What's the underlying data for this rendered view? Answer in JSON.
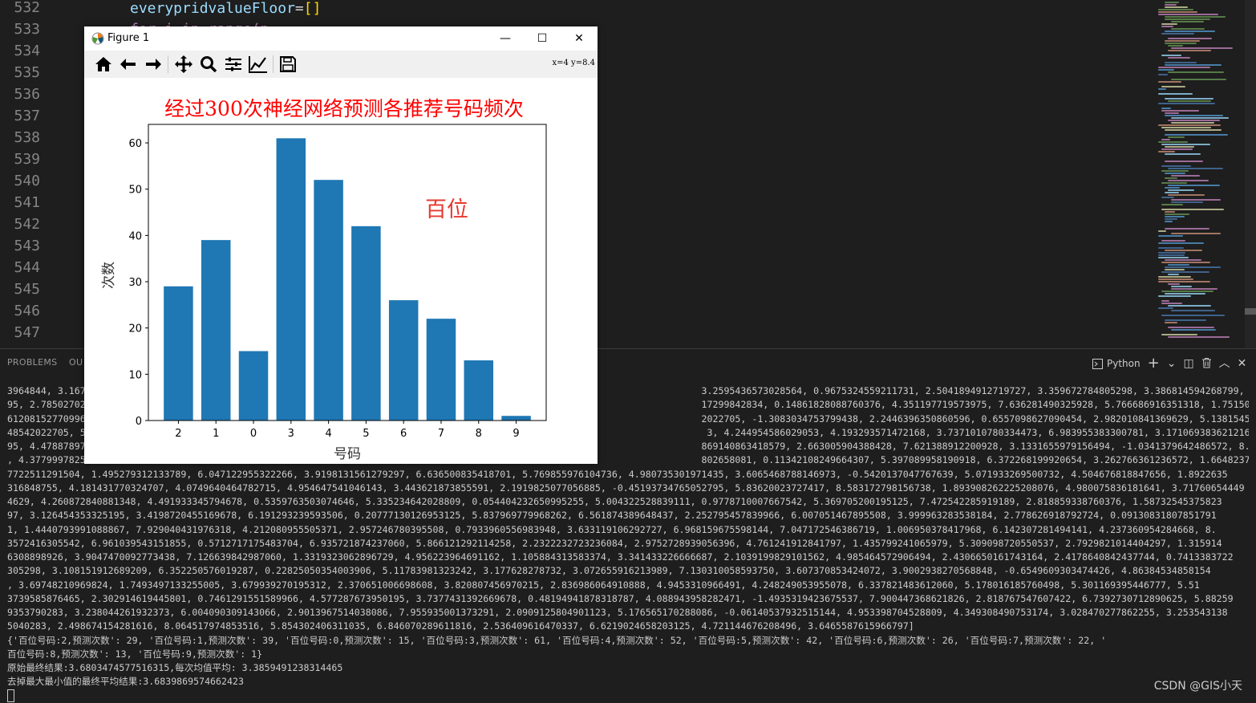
{
  "editor": {
    "line_numbers": [
      "532",
      "533",
      "534",
      "535",
      "536",
      "537",
      "538",
      "539",
      "540",
      "541",
      "542",
      "543",
      "544",
      "545",
      "546",
      "547"
    ],
    "code_line_532": {
      "ident": "everypridvalueFloor",
      "op": "=",
      "brackets": "[]"
    },
    "code_line_533": "for i in range(p"
  },
  "window": {
    "title": "Figure 1",
    "coords_readout": "x=4 y=8.4",
    "controls": {
      "minimize": "—",
      "maximize": "☐",
      "close": "✕"
    }
  },
  "toolbar_icons": [
    "home-icon",
    "back-arrow-icon",
    "forward-arrow-icon",
    "pan-icon",
    "zoom-icon",
    "subplots-config-icon",
    "edit-axis-icon",
    "save-icon"
  ],
  "chart_data": {
    "type": "bar",
    "title": "经过300次神经网络预测各推荐号码频次",
    "annotation": "百位",
    "xlabel": "号码",
    "ylabel": "次数",
    "categories": [
      "2",
      "1",
      "0",
      "3",
      "4",
      "5",
      "6",
      "7",
      "8",
      "9"
    ],
    "values": [
      29,
      39,
      15,
      61,
      52,
      42,
      26,
      22,
      13,
      1
    ],
    "ylim": [
      0,
      64
    ],
    "yticks": [
      0,
      10,
      20,
      30,
      40,
      50,
      60
    ],
    "bar_color": "#1f77b4",
    "title_color": "#ff0000",
    "annotation_color": "#e8392f",
    "grid": false
  },
  "panel": {
    "tabs": [
      "PROBLEMS",
      "OU"
    ],
    "terminal_kind": "Python",
    "actions": {
      "add": "+",
      "dropdown": "⌄",
      "split": "◫",
      "trash": "🗑",
      "maximize": "︿",
      "close": "✕"
    }
  },
  "terminal": {
    "lines": [
      "3964844, 3.167                                                                                                              3.2595436573028564, 0.9675324559211731, 2.5041894912719727, 3.359672784805298, 3.386814594268799, 1.78592806986999",
      "95, 2.78502702                                                                                                              17299842834, 0.14861828088760376, 4.351197719573975, 7.636281490325928, 5.766686916351318, 1.7515069246292114, 6.6",
      "61208152770996                                                                                                              2022705, -1.3083034753799438, 2.2446396350860596, 0.6557098627090454, 2.982010841369629, 5.13815450668335, 2.19125",
      "48542022705, 5                                                                                                               3, 4.244954586029053, 4.193293571472168, 3.7371010780334473, 6.983955383300781, 3.171069383621216, 7.083147048950",
      "95, 4.47887897                                                                                                              869140863418579, 2.663005904388428, 7.621388912200928, 3.1331655979156494, -1.0341379642486572, 8.12972927093505",
      ", 4.37799978255                                                                                                             802658081, 0.11342108249664307, 5.397089958190918, 6.372268199920654, 3.262766361236572, 1.6648237705230713, 4.61",
      "7722511291504, 1.495279312133789, 6.047122955322266, 3.9198131561279297, 6.636500835418701, 5.769855976104736, 4.980735301971435, 3.6065468788146973, -0.5420137047767639, 5.071933269500732, 4.504676818847656, 1.8922635",
      "316848755, 4.181431770324707, 4.0749640464782715, 4.954647541046143, 3.443621873855591, 2.1919825077056885, -0.45193734765052795, 5.83620023727417, 8.583172798156738, 1.893908262225208076, 4.980075836181641, 3.71760654449",
      "4629, 4.260872840881348, 4.491933345794678, 0.5359763503074646, 5.335234642028809, 0.054404232650995255, 5.004322528839111, 0.9778710007667542, 5.369705200195125, 7.472542285919189, 2.818859338760376, 1.58732545375823",
      "97, 3.126454353325195, 3.4198720455169678, 6.191293239593506, 0.20777130126953125, 5.837969779968262, 6.561874389648437, 2.252795457839966, 6.007051467895508, 3.999963283538184, 2.778626918792724, 0.09130831807851791",
      "1, 1.4440793991088867, 7.929040431976318, 4.212080955505371, 2.957246780395508, 0.7933960556983948, 3.633119106292727, 6.968159675598144, 7.047172546386719, 1.006950378417968, 6.142307281494141, 4.237360954284668, 8.",
      "3572416305542, 6.961039543151855, 0.5712717175483704, 6.935721874237060, 5.866121292114258, 2.2322232723236084, 2.9752728939056396, 4.761241912841797, 1.435799241065979, 5.309098720550537, 2.7929821014404297, 1.315914",
      "6308898926, 3.9047470092773438, 7.126639842987060, 1.3319323062896729, 4.956223964691162, 1.105884313583374, 3.341433226666687, 2.1039199829101562, 4.985464572906494, 2.4306650161743164, 2.4178640842437744, 0.7413383722",
      "305298, 3.108151912689209, 6.352250576019287, 0.22825050354003906, 5.11783981323242, 3.177628278732, 3.072655916213989, 7.130310058593750, 3.607370853424072, 3.9002938270568848, -0.6549609303474426, 4.86384534858154",
      ", 3.69748210969824, 1.7493497133255005, 3.679939270195312, 2.370651006698608, 3.820807456970215, 2.836986064910888, 4.9453310966491, 4.248249053955078, 6.337821483612060, 5.178016185760498, 5.301169395446777, 5.51",
      "3739585876465, 2.302914619445801, 0.7461291551589966, 4.577287673950195, 3.7377431392669678, 0.48194941878318787, 4.088943958282471, -1.4935319423675537, 7.900447368621826, 2.818767547607422, 6.7392730712890625, 5.88259",
      "9353790283, 3.238044261932373, 6.004090309143066, 2.9013967514038086, 7.955935001373291, 2.0909125804901123, 5.176565170288086, -0.06140537932515144, 4.953398704528809, 4.349308490753174, 3.028470277862255, 3.253543138",
      "5040283, 2.498674154281616, 8.064517974853516, 5.854302406311035, 6.846070289611816, 2.536409616470337, 6.6219024658203125, 4.721144676208496, 3.6465587615966797]",
      "{'百位号码:2,预测次数': 29, '百位号码:1,预测次数': 39, '百位号码:0,预测次数': 15, '百位号码:3,预测次数': 61, '百位号码:4,预测次数': 52, '百位号码:5,预测次数': 42, '百位号码:6,预测次数': 26, '百位号码:7,预测次数': 22, '",
      "百位号码:8,预测次数': 13, '百位号码:9,预测次数': 1}",
      "原始最终结果:3.6803474577516315,每次均值平均: 3.3859491238314465",
      "去掉最大最小值的最终平均结果:3.6839869574662423"
    ]
  },
  "watermark": "CSDN @GIS小天"
}
